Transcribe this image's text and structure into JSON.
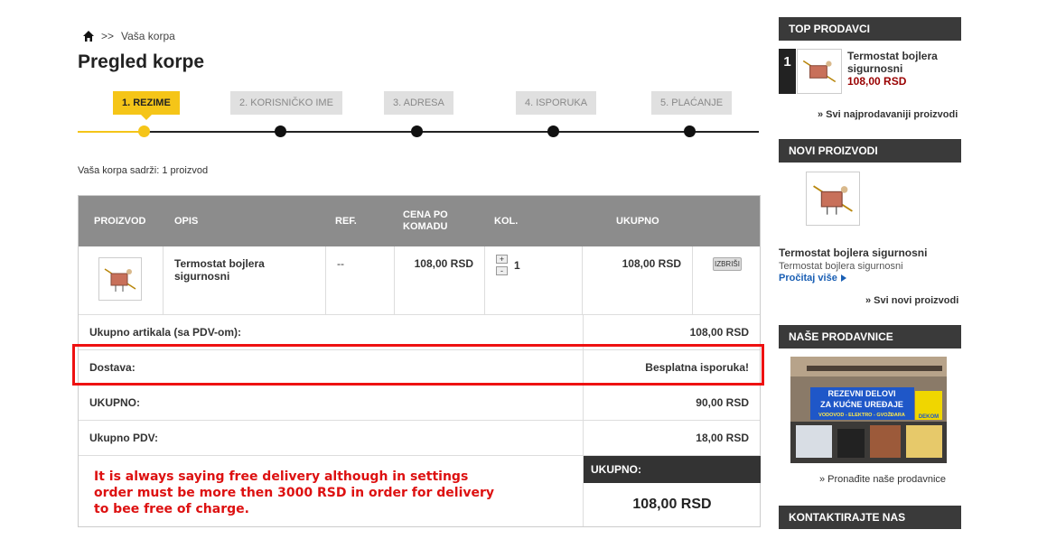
{
  "breadcrumb": {
    "separator": ">>",
    "current": "Vaša korpa"
  },
  "page_title": "Pregled korpe",
  "steps": [
    "1. REZIME",
    "2. KORISNIČKO IME",
    "3. ADRESA",
    "4. ISPORUKA",
    "5. PLAĆANJE"
  ],
  "cart_summary": "Vaša korpa sadrži: 1 proizvod",
  "table": {
    "headers": {
      "product": "PROIZVOD",
      "description": "OPIS",
      "ref": "REF.",
      "unit_price": "CENA PO KOMADU",
      "qty": "KOL.",
      "total": "UKUPNO"
    },
    "item": {
      "name": "Termostat bojlera sigurnosni",
      "ref": "--",
      "unit_price": "108,00 RSD",
      "qty": "1",
      "total": "108,00 RSD",
      "delete": "IZBRIŠI",
      "qty_plus": "+",
      "qty_minus": "-"
    },
    "summary": {
      "items_label": "Ukupno artikala (sa PDV-om):",
      "items_value": "108,00 RSD",
      "delivery_label": "Dostava:",
      "delivery_value": "Besplatna isporuka!",
      "total_label": "UKUPNO:",
      "total_value": "90,00 RSD",
      "vat_label": "Ukupno PDV:",
      "vat_value": "18,00 RSD"
    },
    "grand_total": {
      "label": "UKUPNO:",
      "value": "108,00 RSD"
    }
  },
  "annotation": "It is always saying free delivery although in settings order must be more then 3000 RSD in order for delivery to bee free of charge.",
  "sidebar": {
    "top_sellers": {
      "title": "TOP PRODAVCI",
      "rank": "1",
      "product": "Termostat bojlera sigurnosni",
      "price": "108,00 RSD",
      "more": "» Svi najprodavaniji proizvodi"
    },
    "new_products": {
      "title": "NOVI PROIZVODI",
      "product": "Termostat bojlera sigurnosni",
      "desc": "Termostat bojlera sigurnosni",
      "read_more": "Pročitaj više",
      "more": "» Svi novi proizvodi"
    },
    "stores": {
      "title": "NAŠE PRODAVNICE",
      "sign_line1": "REZEVNI DELOVI",
      "sign_line2": "ZA KUĆNE UREĐAJE",
      "sign_line3": "VODOVOD - ELEKTRO - GVOŽĐARA",
      "logo": "DEKOM",
      "more": "» Pronađite naše prodavnice"
    },
    "contact": {
      "title": "KONTAKTIRAJTE NAS"
    }
  },
  "colors": {
    "accent": "#f5c518",
    "annotation": "#e11111",
    "price": "#990000",
    "link": "#1a5fb4"
  }
}
